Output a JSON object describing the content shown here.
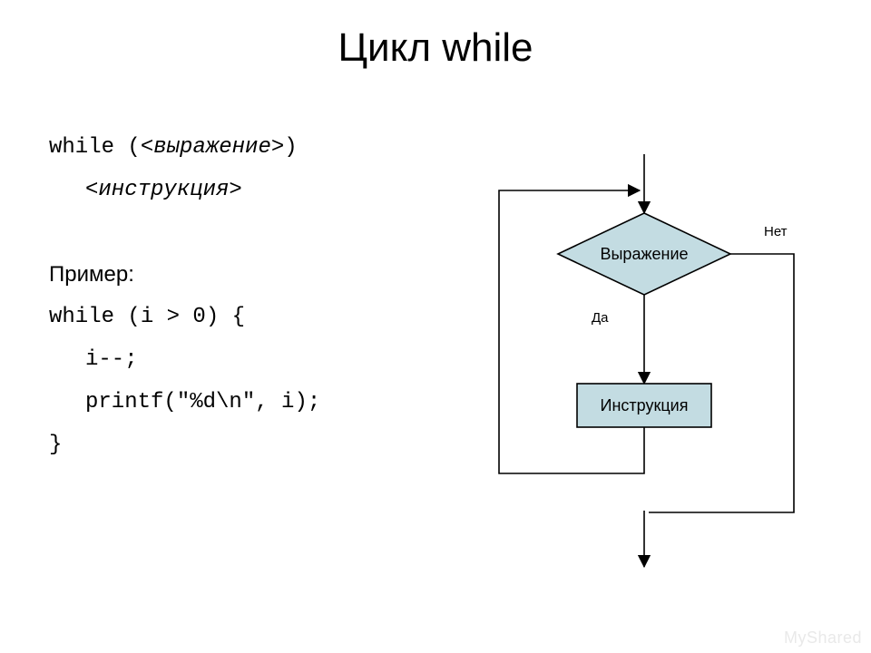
{
  "title": "Цикл while",
  "syntax": {
    "while_open": "while (",
    "expression_placeholder": "<выражение>",
    "while_close": ")",
    "instruction_placeholder": "<инструкция>"
  },
  "example": {
    "label": "Пример:",
    "lines": [
      "while (i > 0) {",
      "i--;",
      "printf(\"%d\\n\", i);",
      "}"
    ]
  },
  "flowchart": {
    "decision": "Выражение",
    "process": "Инструкция",
    "yes": "Да",
    "no": "Нет",
    "node_fill": "#c3dce2"
  },
  "watermark": "MyShared"
}
